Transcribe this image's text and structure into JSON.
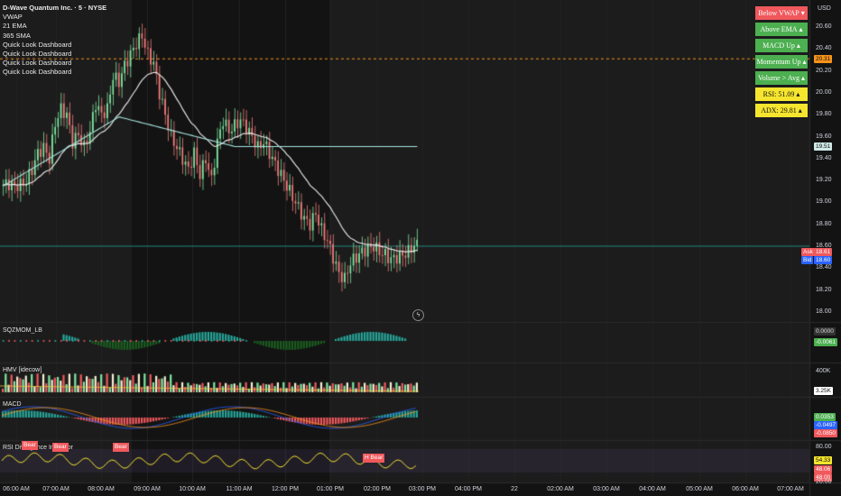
{
  "header": {
    "title": "D-Wave Quantum Inc. · 5 · NYSE",
    "indicators": [
      "VWAP",
      "21 EMA",
      "365 SMA",
      "Quick Look Dashboard",
      "Quick Look Dashboard",
      "Quick Look Dashboard",
      "Quick Look Dashboard"
    ]
  },
  "currency": "USD",
  "dashboard": [
    {
      "label": "Below VWAP",
      "color": "red"
    },
    {
      "label": "Above EMA",
      "color": "green"
    },
    {
      "label": "MACD Up",
      "color": "green"
    },
    {
      "label": "Momentum Up",
      "color": "green"
    },
    {
      "label": "Volume > Avg",
      "color": "green"
    },
    {
      "label": "RSI: 51.09",
      "color": "yellow"
    },
    {
      "label": "ADX: 29.81",
      "color": "yellow"
    }
  ],
  "price_axis": [
    "20.60",
    "20.40",
    "20.20",
    "20.00",
    "19.80",
    "19.60",
    "19.40",
    "19.20",
    "19.00",
    "18.80",
    "18.60",
    "18.40",
    "18.20",
    "18.00"
  ],
  "price_tags": {
    "dashed_level": "20.31",
    "sma_value": "19.51",
    "ask_label": "Ask",
    "ask_value": "18.61",
    "bid_label": "Bid",
    "bid_value": "18.60",
    "last": "18.61"
  },
  "panes": {
    "squeeze": {
      "label": "SQZMOM_LB",
      "values": [
        "0.0000",
        "-0.0061"
      ]
    },
    "volume": {
      "label": "HMV [idecow]",
      "axis": "400K",
      "value": "3.25K"
    },
    "macd": {
      "label": "MACD",
      "values": [
        "0.0353",
        "-0.0497",
        "-0.0850"
      ]
    },
    "rsi": {
      "label": "RSI Divergence Indicator",
      "axis": [
        "80.00",
        "20.00"
      ],
      "values": [
        "54.33",
        "48.06",
        "48.00"
      ],
      "signals": [
        "Bear",
        "Bear",
        "Bear",
        "H Bear"
      ]
    }
  },
  "time_axis": [
    "06:00 AM",
    "07:00 AM",
    "08:00 AM",
    "09:00 AM",
    "10:00 AM",
    "11:00 AM",
    "12:00 PM",
    "01:00 PM",
    "02:00 PM",
    "03:00 PM",
    "04:00 PM",
    "22",
    "02:00 AM",
    "03:00 AM",
    "04:00 AM",
    "05:00 AM",
    "06:00 AM",
    "07:00 AM"
  ],
  "chart_data": {
    "type": "candlestick",
    "title": "D-Wave Quantum Inc. · 5 · NYSE",
    "ylim": [
      18.0,
      20.7
    ],
    "close_path": [
      19.16,
      19.17,
      19.15,
      19.16,
      19.19,
      19.3,
      19.45,
      19.5,
      19.4,
      19.72,
      19.85,
      19.8,
      19.55,
      19.62,
      19.5,
      19.65,
      19.9,
      19.8,
      19.85,
      20.15,
      20.1,
      20.25,
      20.35,
      20.45,
      20.52,
      20.35,
      20.27,
      20.0,
      19.8,
      19.6,
      19.5,
      19.4,
      19.3,
      19.45,
      19.25,
      19.4,
      19.2,
      19.55,
      19.75,
      19.65,
      19.7,
      19.75,
      19.68,
      19.6,
      19.5,
      19.55,
      19.45,
      19.35,
      19.25,
      19.15,
      19.05,
      18.95,
      18.85,
      18.8,
      18.9,
      18.75,
      18.65,
      18.5,
      18.35,
      18.3,
      18.45,
      18.5,
      18.55,
      18.58,
      18.6,
      18.55,
      18.52,
      18.48,
      18.5,
      18.52,
      18.55,
      18.61
    ],
    "vwap_value": 18.6,
    "sma_value": 19.51,
    "dashed_level": 20.31
  }
}
